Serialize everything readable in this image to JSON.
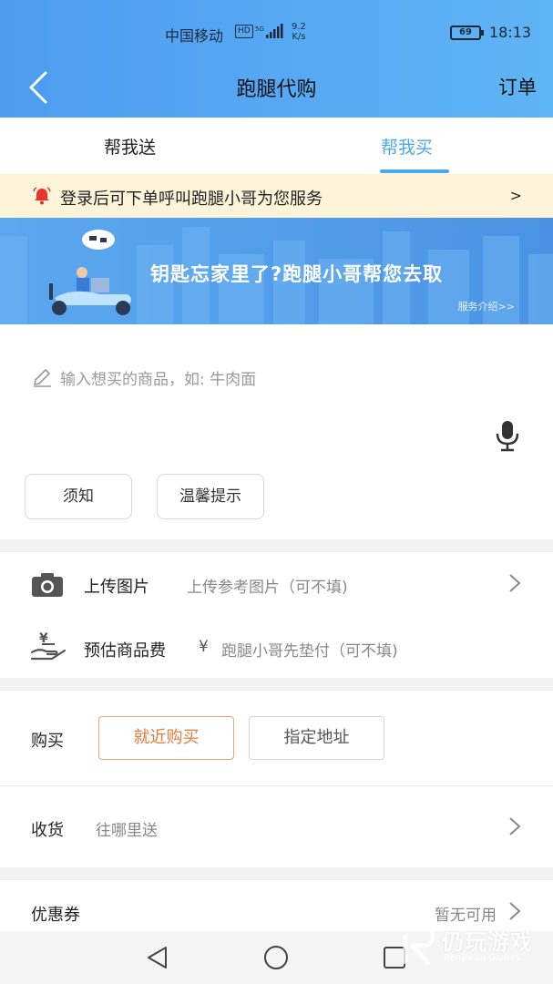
{
  "status_bar": {
    "carrier": "中国移动",
    "hd": "HD",
    "speed_value": "9.2",
    "speed_unit": "K/s",
    "battery": "69",
    "time": "18:13"
  },
  "nav": {
    "title": "跑腿代购",
    "order_label": "订单"
  },
  "tabs": [
    {
      "label": "帮我送",
      "active": false
    },
    {
      "label": "帮我买",
      "active": true
    }
  ],
  "notice": {
    "text": "登录后可下单呼叫跑腿小哥为您服务",
    "arrow": ">"
  },
  "banner": {
    "headline": "钥匙忘家里了?跑腿小哥帮您去取",
    "link": "服务介绍>>"
  },
  "input": {
    "placeholder": "输入想买的商品，如: 牛肉面"
  },
  "chips": {
    "notice": "须知",
    "tips": "温馨提示"
  },
  "upload": {
    "label": "上传图片",
    "hint": "上传参考图片（可不填)"
  },
  "fee": {
    "label": "预估商品费",
    "currency": "¥",
    "hint": "跑腿小哥先垫付（可不填)"
  },
  "buy": {
    "label": "购买",
    "options": [
      {
        "label": "就近购买",
        "selected": true
      },
      {
        "label": "指定地址",
        "selected": false
      }
    ]
  },
  "receive": {
    "label": "收货",
    "hint": "往哪里送"
  },
  "coupon": {
    "label": "优惠券",
    "value": "暂无可用"
  },
  "watermark": {
    "text": "仍玩游戏",
    "sub": "Rengwan Games"
  },
  "colors": {
    "header_blue": "#4d9cf0",
    "tab_active": "#4aa9ec",
    "accent_orange": "#e07b3c",
    "notice_bg": "#fdf4d9"
  }
}
